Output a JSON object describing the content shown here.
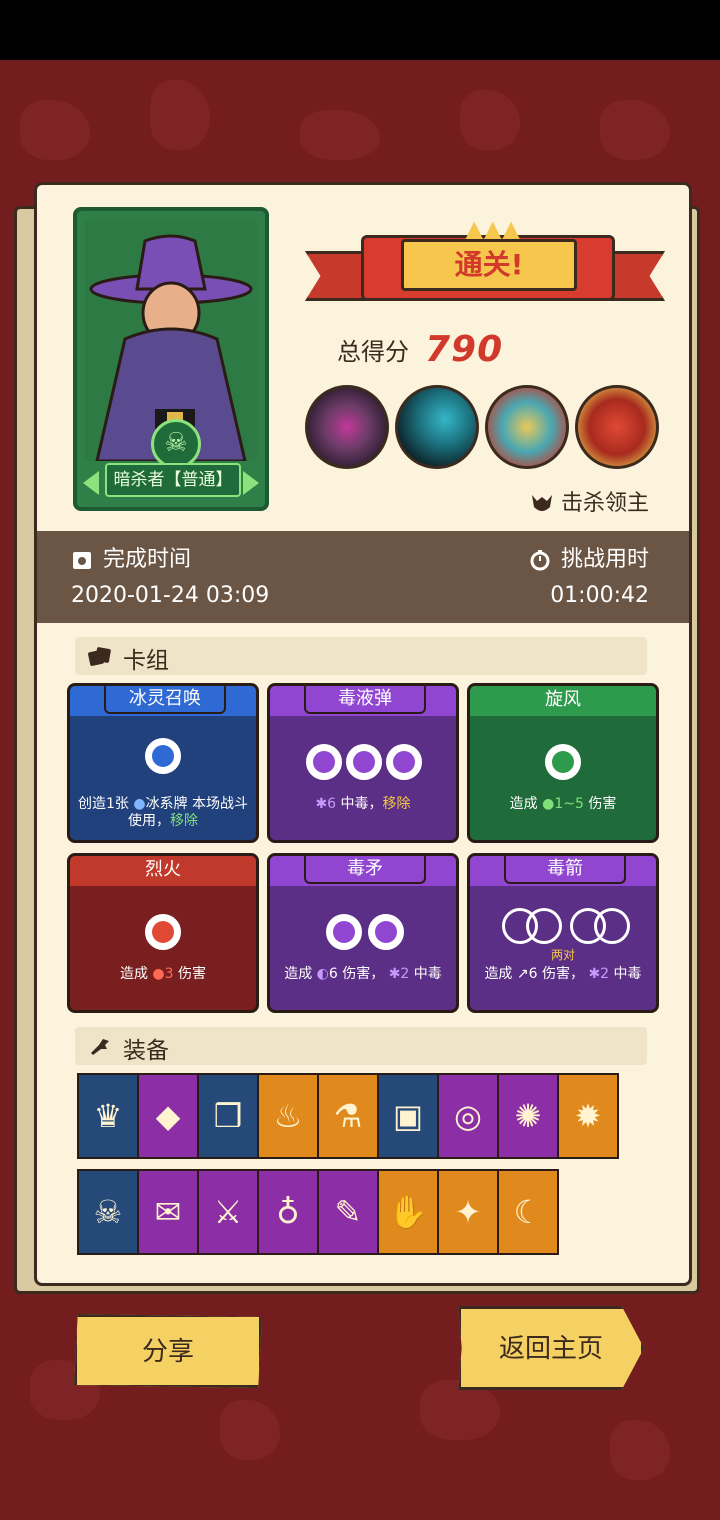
{
  "result": {
    "title": "通关!",
    "score_label": "总得分",
    "score_value": "790",
    "kill_boss_label": "击杀领主"
  },
  "character": {
    "name": "暗杀者【普通】"
  },
  "info": {
    "finish_time_label": "完成时间",
    "finish_time_value": "2020-01-24 03:09",
    "challenge_time_label": "挑战用时",
    "challenge_time_value": "01:00:42"
  },
  "deck": {
    "title": "卡组",
    "cards": [
      {
        "name": "冰灵召唤",
        "desc_a": "创造1张",
        "desc_b": "冰系牌 本场战斗使用，",
        "desc_c": "移除"
      },
      {
        "name": "毒液弹",
        "desc_a": "6",
        "desc_b": "中毒，",
        "desc_c": "移除"
      },
      {
        "name": "旋风",
        "desc_a": "造成",
        "desc_b": "1~5",
        "desc_c": "伤害"
      },
      {
        "name": "烈火",
        "desc_a": "造成",
        "desc_b": "3",
        "desc_c": "伤害"
      },
      {
        "name": "毒矛",
        "desc_a": "造成",
        "desc_b": "6 伤害，",
        "desc_c": "2",
        "desc_d": "中毒"
      },
      {
        "name": "毒箭",
        "sub": "两对",
        "desc_a": "造成",
        "desc_b": "6 伤害，",
        "desc_c": "2",
        "desc_d": "中毒"
      }
    ]
  },
  "equipment": {
    "title": "装备",
    "row1": [
      {
        "icon": "ice-crown-icon",
        "color": "#254a79"
      },
      {
        "icon": "dark-crystal-icon",
        "color": "#8c2fa6"
      },
      {
        "icon": "scroll-bundle-icon",
        "color": "#254a79"
      },
      {
        "icon": "smoke-pipe-icon",
        "color": "#e08a1e"
      },
      {
        "icon": "eye-flask-icon",
        "color": "#e08a1e"
      },
      {
        "icon": "gold-box-icon",
        "color": "#254a79"
      },
      {
        "icon": "gold-ring-orb-icon",
        "color": "#8c2fa6"
      },
      {
        "icon": "purple-splash-icon",
        "color": "#8c2fa6"
      },
      {
        "icon": "spiked-orb-icon",
        "color": "#e08a1e"
      }
    ],
    "row2": [
      {
        "icon": "skull-icon",
        "color": "#254a79"
      },
      {
        "icon": "fire-scroll-icon",
        "color": "#8c2fa6"
      },
      {
        "icon": "green-dagger-icon",
        "color": "#8c2fa6"
      },
      {
        "icon": "emerald-ring-icon",
        "color": "#8c2fa6"
      },
      {
        "icon": "fire-feather-icon",
        "color": "#8c2fa6"
      },
      {
        "icon": "red-glove-icon",
        "color": "#e08a1e"
      },
      {
        "icon": "fire-orb-icon",
        "color": "#e08a1e"
      },
      {
        "icon": "moon-stone-icon",
        "color": "#e08a1e"
      }
    ]
  },
  "buttons": {
    "share": "分享",
    "home": "返回主页"
  }
}
